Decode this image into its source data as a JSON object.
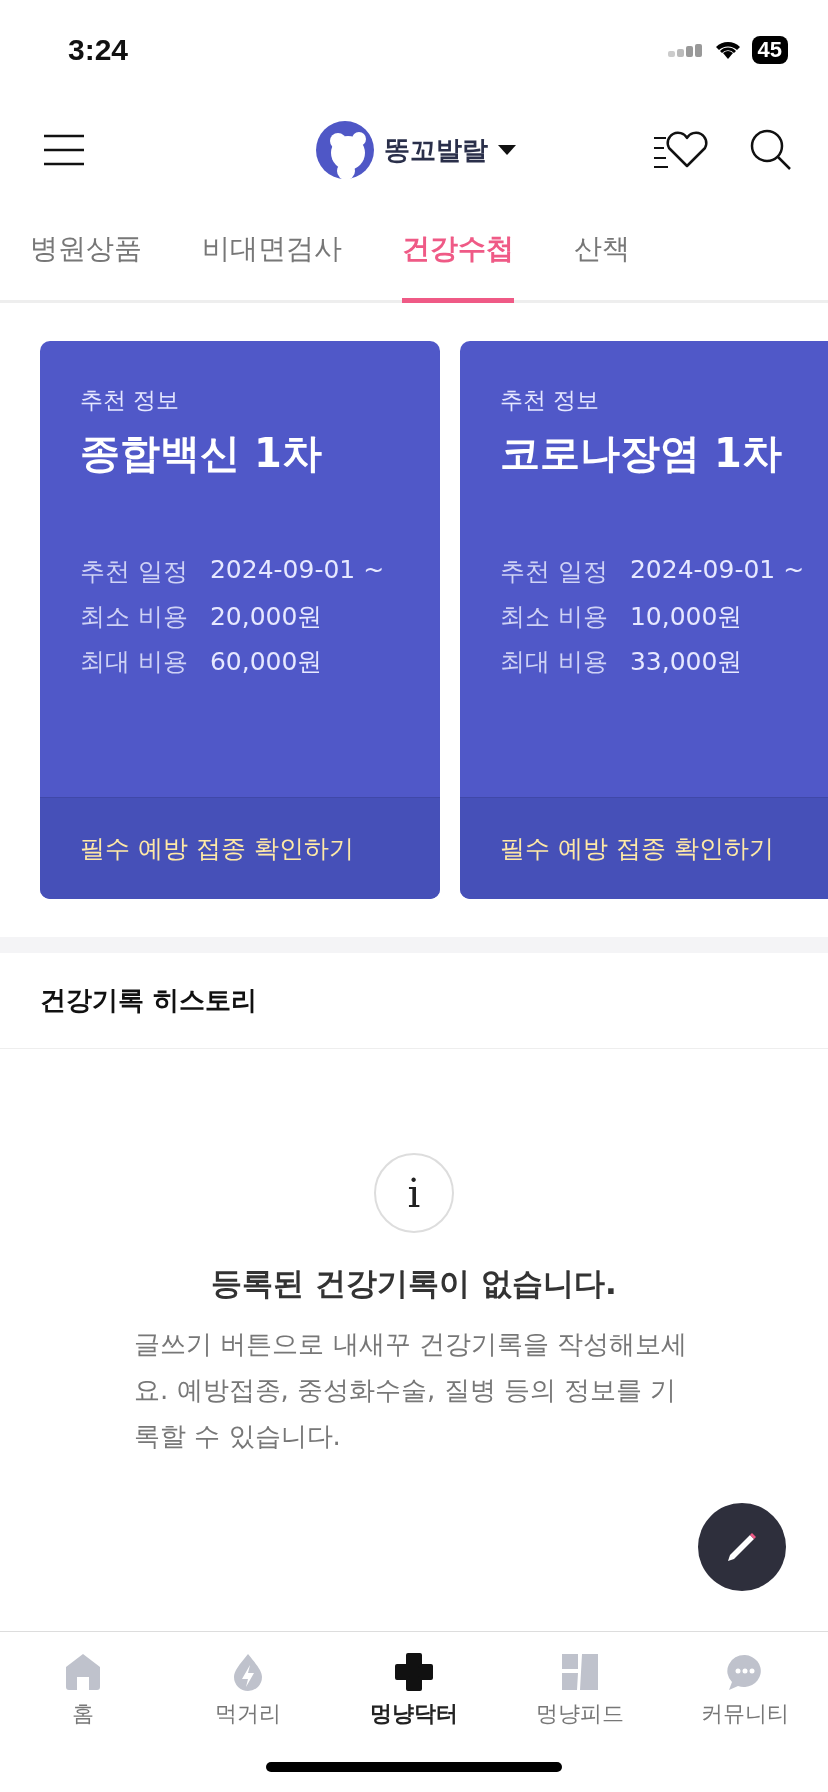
{
  "status_bar": {
    "time": "3:24",
    "battery": "45"
  },
  "header": {
    "profile_name": "똥꼬발랄"
  },
  "tabs": [
    {
      "label": "병원상품",
      "selected": false
    },
    {
      "label": "비대면검사",
      "selected": false
    },
    {
      "label": "건강수첩",
      "selected": true
    },
    {
      "label": "산책",
      "selected": false
    }
  ],
  "cards": [
    {
      "eyebrow": "추천 정보",
      "title": "종합백신 1차",
      "rows": [
        {
          "label": "추천 일정",
          "value": "2024-09-01 ~"
        },
        {
          "label": "최소 비용",
          "value": "20,000원"
        },
        {
          "label": "최대 비용",
          "value": "60,000원"
        }
      ],
      "action": "필수 예방 접종 확인하기"
    },
    {
      "eyebrow": "추천 정보",
      "title": "코로나장염 1차",
      "rows": [
        {
          "label": "추천 일정",
          "value": "2024-09-01 ~"
        },
        {
          "label": "최소 비용",
          "value": "10,000원"
        },
        {
          "label": "최대 비용",
          "value": "33,000원"
        }
      ],
      "action": "필수 예방 접종 확인하기"
    }
  ],
  "history": {
    "title": "건강기록 히스토리",
    "empty_icon": "i",
    "empty_title": "등록된 건강기록이 없습니다.",
    "empty_text": "글쓰기 버튼으로 내새꾸 건강기록을 작성해보세요. 예방접종, 중성화수술, 질병 등의 정보를 기록할 수 있습니다."
  },
  "bottom_nav": [
    {
      "kind": "home",
      "label": "홈",
      "selected": false
    },
    {
      "kind": "food",
      "label": "먹거리",
      "selected": false
    },
    {
      "kind": "doctor",
      "label": "멍냥닥터",
      "selected": true
    },
    {
      "kind": "feed",
      "label": "멍냥피드",
      "selected": false
    },
    {
      "kind": "community",
      "label": "커뮤니티",
      "selected": false
    }
  ]
}
